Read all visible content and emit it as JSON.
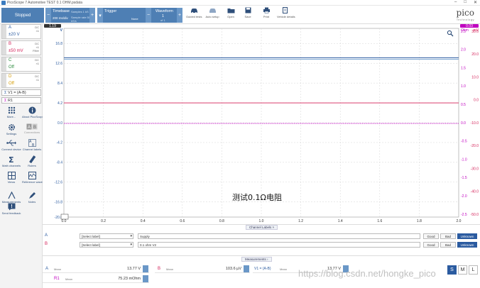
{
  "window": {
    "title": "PicoScope 7 Automotive TEST 0.1 OHM.psdata"
  },
  "toolbar": {
    "stop_label": "Stopped",
    "timebase": {
      "label": "Timebase",
      "value": "200 ms/div",
      "samples": "Samples 1 kS",
      "sample_rate": "Sample rate 500 kS/s"
    },
    "trigger": {
      "label": "Trigger",
      "mode": "None"
    },
    "waveform": {
      "label": "Waveform",
      "index": "1",
      "of": "of 1"
    },
    "tools": [
      {
        "label": "Guided tests",
        "icon": "car-icon"
      },
      {
        "label": "Auto setup",
        "icon": "car-auto-icon"
      },
      {
        "label": "Open",
        "icon": "folder-icon"
      },
      {
        "label": "Save",
        "icon": "save-icon"
      },
      {
        "label": "Print",
        "icon": "printer-icon"
      },
      {
        "label": "Vehicle details",
        "icon": "clipboard-icon"
      }
    ],
    "logo": "pico",
    "logo_sub": "Technology"
  },
  "sidebar": {
    "channels": [
      {
        "name": "A",
        "value": "±20 V",
        "coupling": "DC\n×1",
        "color": "#2b5ba0"
      },
      {
        "name": "B",
        "value": "±50 mV",
        "coupling": "DC\n×1\nFilter",
        "color": "#d4235a"
      },
      {
        "name": "C",
        "value": "Off",
        "coupling": "DC\n×1",
        "color": "#2c8a3d"
      },
      {
        "name": "D",
        "value": "Off",
        "coupling": "DC\n×1",
        "color": "#d49b00"
      }
    ],
    "math": [
      {
        "label": "V1 = (A-B)",
        "color": "#2b5ba0"
      },
      {
        "label": "R1",
        "color": "#c000c0"
      }
    ],
    "tools": [
      {
        "label": "More...",
        "icon": "grid-icon"
      },
      {
        "label": "About PicoScope 7",
        "icon": "info-icon"
      },
      {
        "label": "Settings",
        "icon": "gear-icon"
      },
      {
        "label": "Connections",
        "icon": "connections-icon"
      },
      {
        "label": "Connect device",
        "icon": "usb-icon"
      },
      {
        "label": "Channel labels",
        "icon": "channel-labels-icon"
      },
      {
        "label": "Math channels",
        "icon": "sigma-icon"
      },
      {
        "label": "Rulers",
        "icon": "ruler-icon"
      },
      {
        "label": "Views",
        "icon": "views-icon"
      },
      {
        "label": "Reference waveforms",
        "icon": "reference-icon"
      },
      {
        "label": "Measurements",
        "icon": "measurement-icon"
      },
      {
        "label": "Notes",
        "icon": "notes-icon"
      },
      {
        "label": "Send feedback",
        "icon": "feedback-icon"
      }
    ]
  },
  "scope": {
    "left_unit": "V",
    "right_unit_ohm": "Ohm",
    "right_unit_mv": "mV",
    "ruler_left": "1.19",
    "ruler_right": "0.03",
    "annotation": "测试0.1Ω电阻"
  },
  "chart_data": {
    "type": "line",
    "xlabel": "",
    "xlim": [
      0,
      2.0
    ],
    "xticks": [
      "0.0",
      "0.2",
      "0.4",
      "0.6",
      "0.8",
      "1.0",
      "1.2",
      "1.4",
      "1.6",
      "1.8",
      "2.0"
    ],
    "left_axis_A": {
      "ticks": [
        "16.8",
        "12.6",
        "8.4",
        "4.2",
        "0.0",
        "-4.2",
        "-8.4",
        "-12.6",
        "-16.8",
        "-20.0"
      ],
      "ylim": [
        -20,
        20
      ],
      "color": "#2b5ba0"
    },
    "right_axis_ohm": {
      "ticks": [
        "2.5",
        "2.0",
        "1.5",
        "1.0",
        "0.5",
        "0.0",
        "-0.5",
        "-1.0",
        "-1.5",
        "-2.0",
        "-2.5"
      ],
      "color": "#c000c0"
    },
    "right_axis_mv": {
      "ticks": [
        "30.0",
        "20.0",
        "10.0",
        "0.0",
        "-10.0",
        "-20.0",
        "-30.0",
        "-40.0",
        "-50.0"
      ],
      "color": "#d4235a"
    },
    "series": [
      {
        "name": "A",
        "constant": 13.77,
        "color": "#2b5ba0"
      },
      {
        "name": "V1 = (A-B)",
        "constant": 13.77,
        "color": "#6a9acc"
      },
      {
        "name": "B",
        "constant": 4.2,
        "color": "#d4235a"
      },
      {
        "name": "R1",
        "constant": 0.0,
        "color": "#c000c0"
      }
    ]
  },
  "channel_labels": {
    "tab": "Channel Labels",
    "rows": [
      {
        "channel": "A",
        "select": "[Select label]",
        "value": "Supply",
        "color": "#2b5ba0"
      },
      {
        "channel": "B",
        "select": "[Select label]",
        "value": "0.1 ohm V2",
        "color": "#d4235a"
      }
    ],
    "buttons": [
      "Good",
      "Bad",
      "Unknown"
    ]
  },
  "measurements": {
    "tab": "Measurements",
    "cells": [
      {
        "channel": "A",
        "label": "Mean",
        "value": "13.77 V",
        "color": "#2b5ba0"
      },
      {
        "channel": "B",
        "label": "Mean",
        "value": "103.6 µV",
        "color": "#d4235a"
      },
      {
        "channel": "V1 = (A-B)",
        "label": "Mean",
        "value": "13.77 V",
        "color": "#2b5ba0"
      },
      {
        "channel": "R1",
        "label": "Mean",
        "value": "75.23 mOhm",
        "color": "#c000c0"
      }
    ],
    "sizes": [
      "S",
      "M",
      "L"
    ]
  },
  "watermark": "https://blog.csdn.net/hongke_pico"
}
